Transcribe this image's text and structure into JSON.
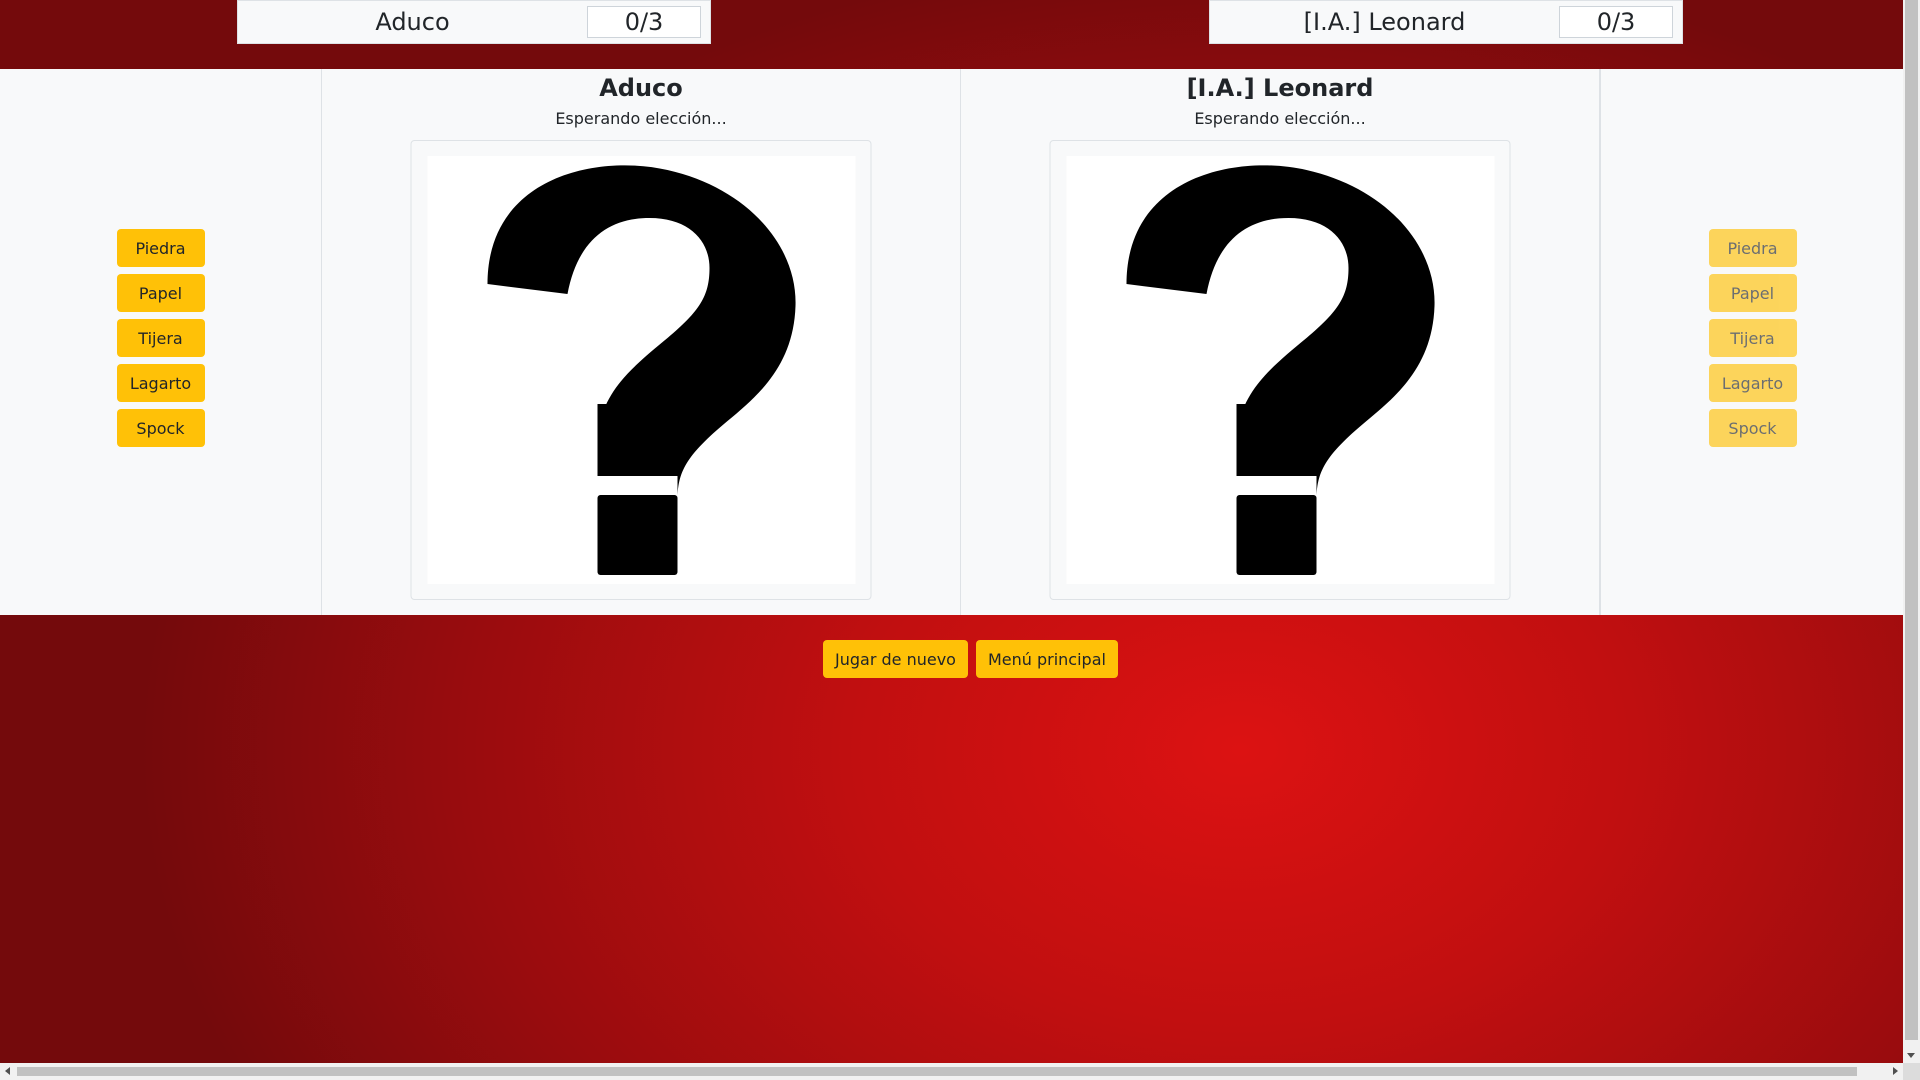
{
  "scoreboard": {
    "player1": {
      "name": "Aduco",
      "score": "0/3"
    },
    "player2": {
      "name": "[I.A.] Leonard",
      "score": "0/3"
    }
  },
  "players": [
    {
      "name": "Aduco",
      "status": "Esperando elección..."
    },
    {
      "name": "[I.A.] Leonard",
      "status": "Esperando elección..."
    }
  ],
  "moves_left": [
    "Piedra",
    "Papel",
    "Tijera",
    "Lagarto",
    "Spock"
  ],
  "moves_right": [
    "Piedra",
    "Papel",
    "Tijera",
    "Lagarto",
    "Spock"
  ],
  "actions": {
    "play_again": "Jugar de nuevo",
    "main_menu": "Menú principal"
  },
  "icons": {
    "choice_placeholder": "question-mark-icon"
  },
  "colors": {
    "accent": "#ffc107",
    "background": "#c10f10",
    "panel": "#f8f9fa"
  }
}
